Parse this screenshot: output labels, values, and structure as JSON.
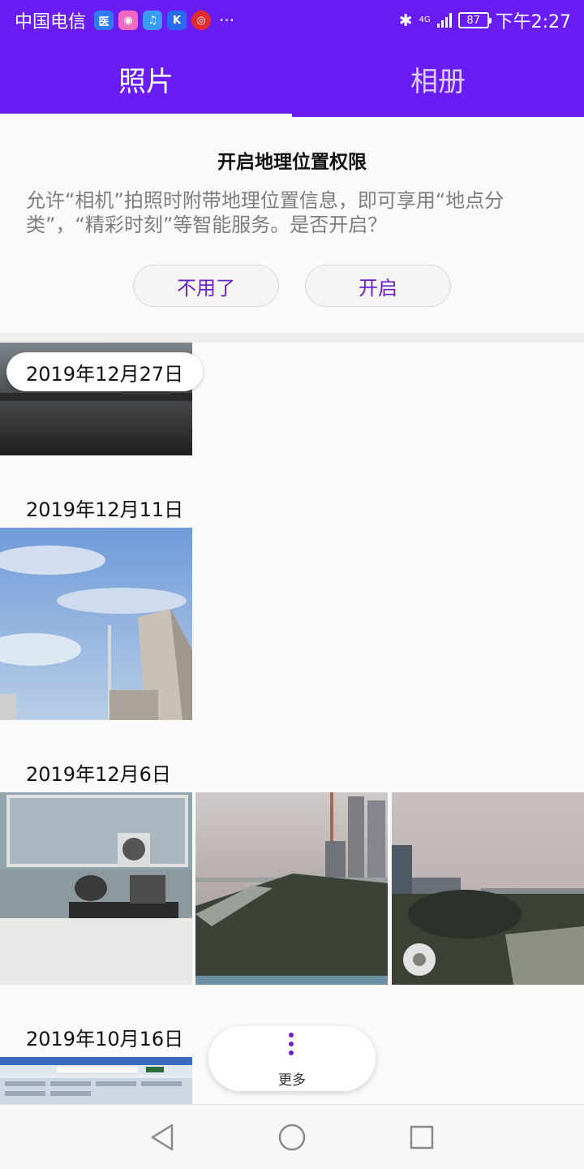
{
  "status_bar": {
    "carrier": "中国电信",
    "app_icons": [
      {
        "name": "app-icon-a",
        "glyph": "医",
        "color": "#2d7bf0"
      },
      {
        "name": "app-icon-b",
        "glyph": "◉",
        "color": "#f06ac0"
      },
      {
        "name": "music-icon",
        "glyph": "♫",
        "color": "#3a9bf5"
      },
      {
        "name": "app-icon-k",
        "glyph": "K",
        "color": "#2a6cf0"
      },
      {
        "name": "netease-music-icon",
        "glyph": "◎",
        "color": "#e42c2c"
      }
    ],
    "more_notifications": "···",
    "network": "4G",
    "battery": "87",
    "time": "下午2:27"
  },
  "tabs": {
    "photos": "照片",
    "albums": "相册"
  },
  "location_prompt": {
    "title": "开启地理位置权限",
    "body": "允许“相机”拍照时附带地理位置信息，即可享用“地点分类”，“精彩时刻”等智能服务。是否开启？",
    "decline_label": "不用了",
    "enable_label": "开启"
  },
  "photo_groups": [
    {
      "date": "2019年12月27日"
    },
    {
      "date": "2019年12月11日"
    },
    {
      "date": "2019年12月6日"
    },
    {
      "date": "2019年10月16日"
    }
  ],
  "more_button": {
    "label": "更多"
  },
  "colors": {
    "accent": "#6a1cf5",
    "button_text": "#6a22c8"
  }
}
